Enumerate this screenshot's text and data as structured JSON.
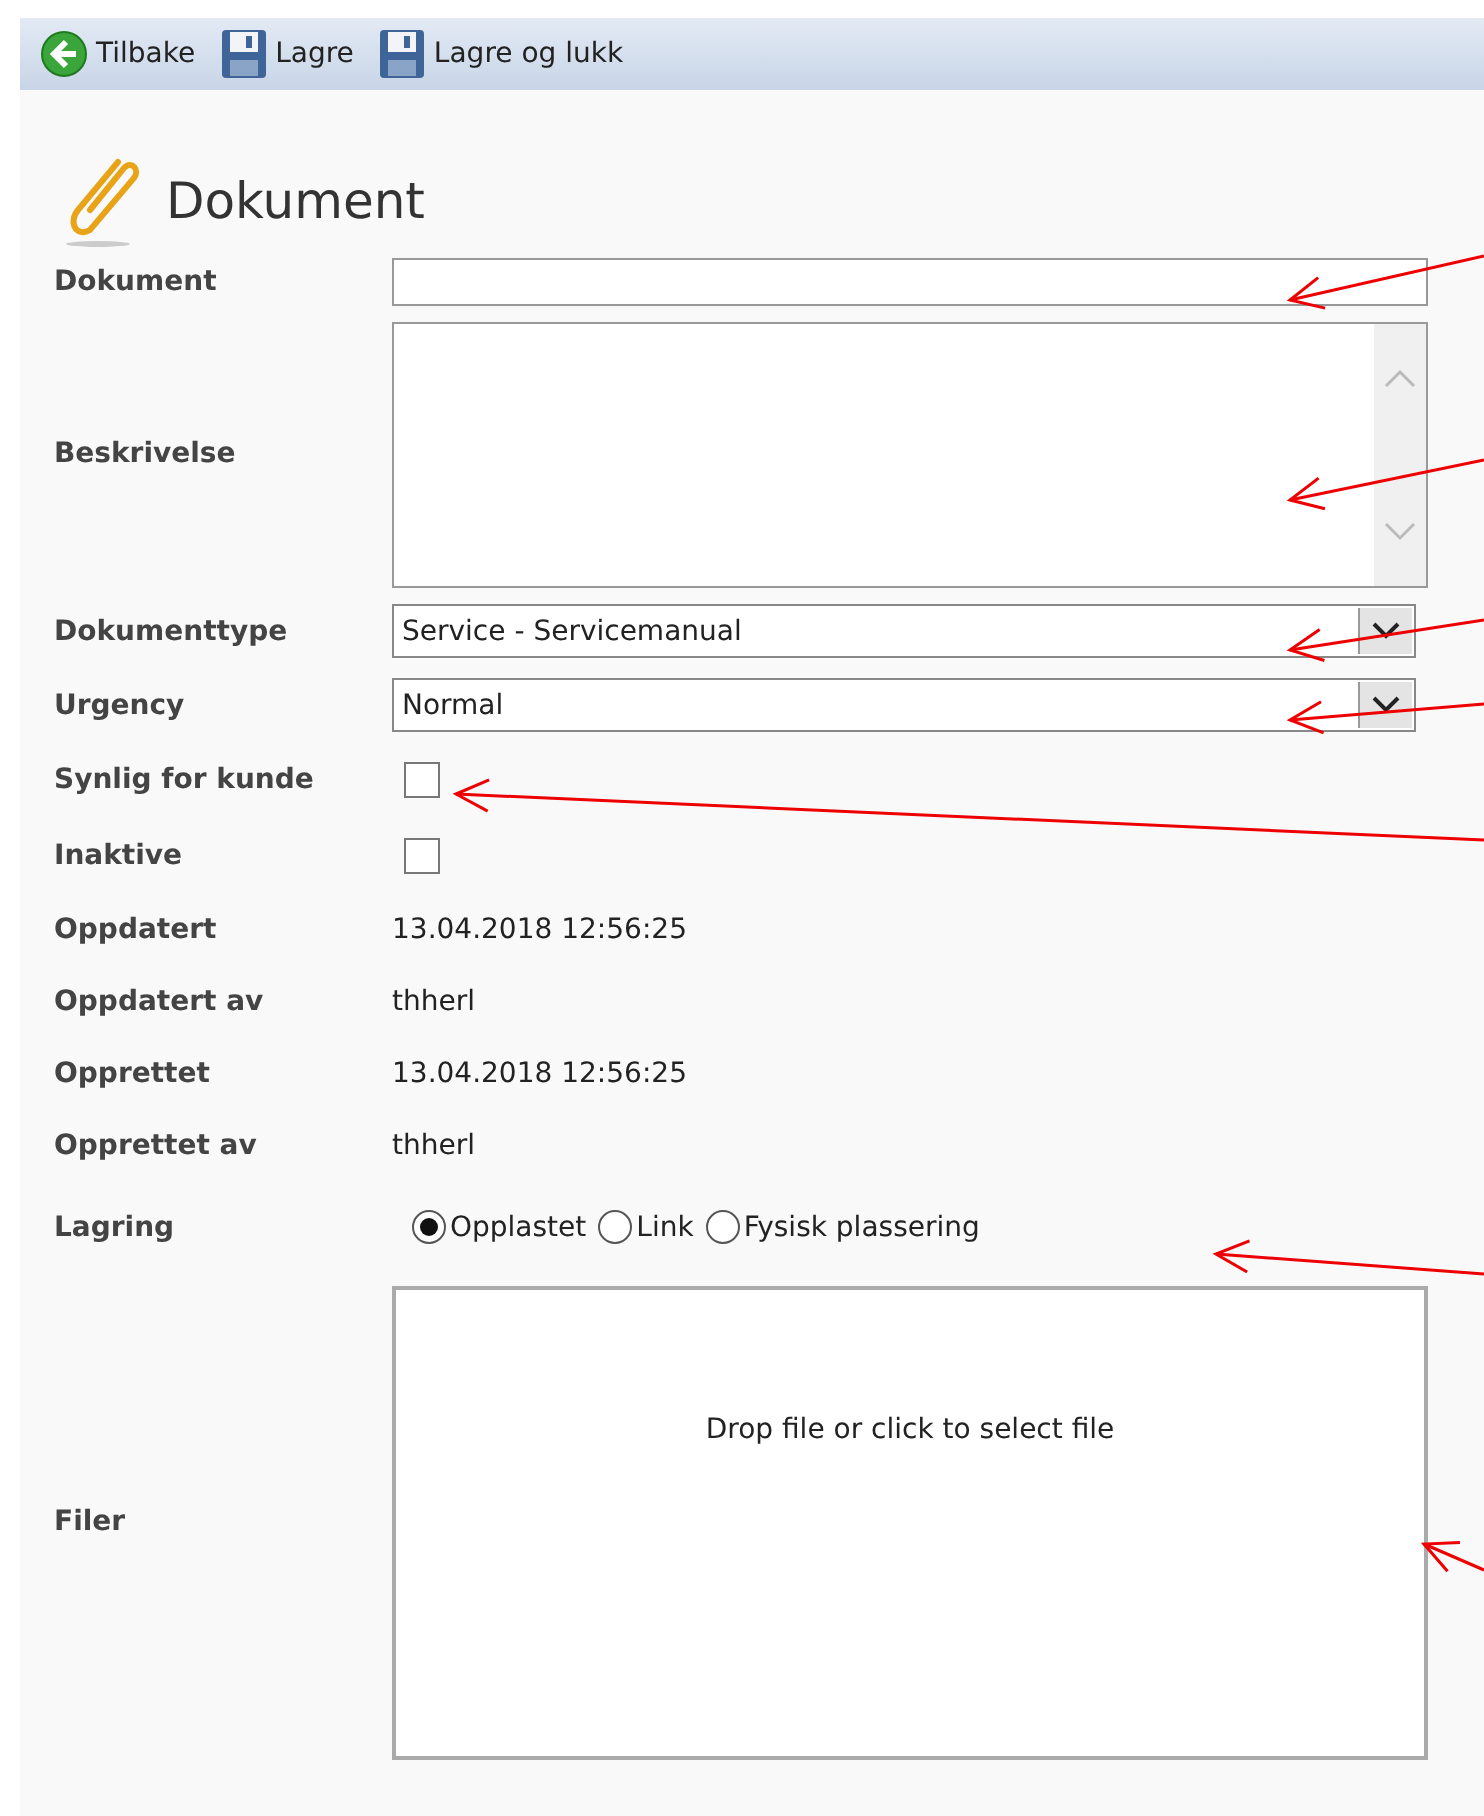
{
  "toolbar": [
    {
      "kind": "back",
      "label": "Tilbake"
    },
    {
      "kind": "save",
      "label": "Lagre"
    },
    {
      "kind": "save",
      "label": "Lagre og lukk"
    }
  ],
  "heading": "Dokument",
  "fields": [
    {
      "kind": "text",
      "label": "Dokument"
    },
    {
      "kind": "textarea",
      "label": "Beskrivelse"
    },
    {
      "kind": "select",
      "label": "Dokumenttype",
      "value": "Service - Servicemanual"
    },
    {
      "kind": "select",
      "label": "Urgency",
      "value": "Normal"
    },
    {
      "kind": "checkbox",
      "label": "Synlig for kunde",
      "checked": false
    },
    {
      "kind": "checkbox",
      "label": "Inaktive",
      "checked": false
    },
    {
      "kind": "static",
      "label": "Oppdatert",
      "value": "13.04.2018 12:56:25"
    },
    {
      "kind": "static",
      "label": "Oppdatert av",
      "value": "thherl"
    },
    {
      "kind": "static",
      "label": "Opprettet",
      "value": "13.04.2018 12:56:25"
    },
    {
      "kind": "static",
      "label": "Opprettet av",
      "value": "thherl"
    },
    {
      "kind": "radio",
      "label": "Lagring",
      "options": [
        {
          "label": "Opplastet",
          "selected": true
        },
        {
          "label": "Link",
          "selected": false
        },
        {
          "label": "Fysisk plassering",
          "selected": false
        }
      ]
    },
    {
      "kind": "dropzone",
      "label": "Filer",
      "text": "Drop file or click to select file"
    }
  ]
}
